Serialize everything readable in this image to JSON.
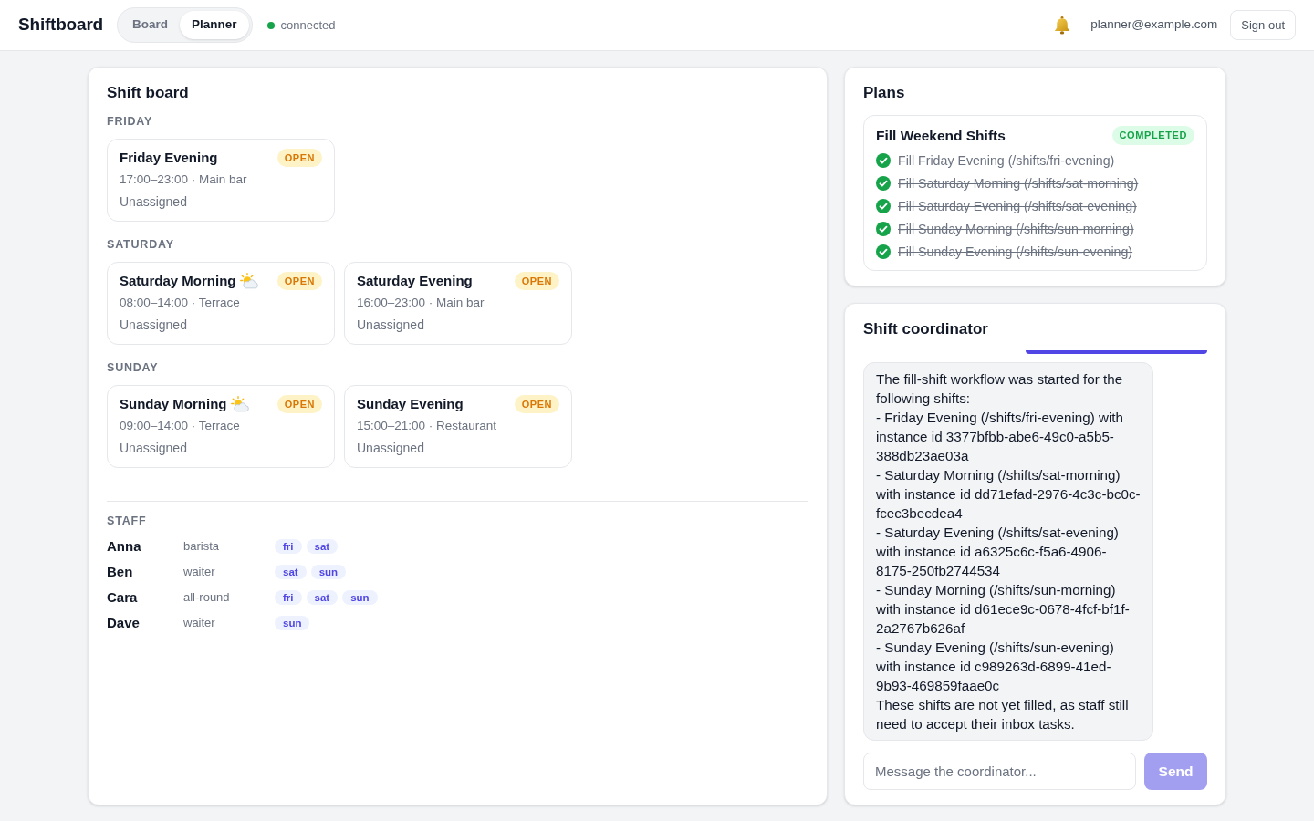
{
  "app": {
    "title": "Shiftboard"
  },
  "nav_tabs": [
    {
      "label": "Board",
      "selected": false
    },
    {
      "label": "Planner",
      "selected": true
    }
  ],
  "connection": {
    "label": "connected",
    "online": true
  },
  "account": {
    "email": "planner@example.com",
    "sign_out": "Sign out"
  },
  "shift_board": {
    "title": "Shift board",
    "days": [
      {
        "label": "FRIDAY",
        "shifts": [
          {
            "kind": "evening",
            "title": "Friday Evening",
            "status": "OPEN",
            "detail": "17:00–23:00 · Main bar",
            "assignee": "Unassigned"
          }
        ]
      },
      {
        "label": "SATURDAY",
        "shifts": [
          {
            "kind": "morning",
            "title": "Saturday Morning",
            "status": "OPEN",
            "detail": "08:00–14:00 · Terrace",
            "assignee": "Unassigned"
          },
          {
            "kind": "evening",
            "title": "Saturday Evening",
            "status": "OPEN",
            "detail": "16:00–23:00 · Main bar",
            "assignee": "Unassigned"
          }
        ]
      },
      {
        "label": "SUNDAY",
        "shifts": [
          {
            "kind": "morning",
            "title": "Sunday Morning",
            "status": "OPEN",
            "detail": "09:00–14:00 · Terrace",
            "assignee": "Unassigned"
          },
          {
            "kind": "evening",
            "title": "Sunday Evening",
            "status": "OPEN",
            "detail": "15:00–21:00 · Restaurant",
            "assignee": "Unassigned"
          }
        ]
      }
    ],
    "staff": {
      "label": "STAFF",
      "members": [
        {
          "name": "Anna",
          "role": "barista",
          "days": [
            "fri",
            "sat"
          ]
        },
        {
          "name": "Ben",
          "role": "waiter",
          "days": [
            "sat",
            "sun"
          ]
        },
        {
          "name": "Cara",
          "role": "all-round",
          "days": [
            "fri",
            "sat",
            "sun"
          ]
        },
        {
          "name": "Dave",
          "role": "waiter",
          "days": [
            "sun"
          ]
        }
      ]
    }
  },
  "plans": {
    "title": "Plans",
    "items": [
      {
        "title": "Fill Weekend Shifts",
        "status": "COMPLETED",
        "steps": [
          {
            "label": "Fill Friday Evening (/shifts/fri-evening)",
            "done": true
          },
          {
            "label": "Fill Saturday Morning (/shifts/sat-morning)",
            "done": true
          },
          {
            "label": "Fill Saturday Evening (/shifts/sat-evening)",
            "done": true
          },
          {
            "label": "Fill Sunday Morning (/shifts/sun-morning)",
            "done": true
          },
          {
            "label": "Fill Sunday Evening (/shifts/sun-evening)",
            "done": true
          }
        ]
      }
    ]
  },
  "coordinator": {
    "title": "Shift coordinator",
    "messages": [
      {
        "kind": "user"
      },
      {
        "kind": "assistant",
        "text": "The fill-shift workflow was started for the following shifts:\n- Friday Evening (/shifts/fri-evening) with instance id 3377bfbb-abe6-49c0-a5b5-388db23ae03a\n- Saturday Morning (/shifts/sat-morning) with instance id dd71efad-2976-4c3c-bc0c-fcec3becdea4\n- Saturday Evening (/shifts/sat-evening) with instance id a6325c6c-f5a6-4906-8175-250fb2744534\n- Sunday Morning (/shifts/sun-morning) with instance id d61ece9c-0678-4fcf-bf1f-2a2767b626af\n- Sunday Evening (/shifts/sun-evening) with instance id c989263d-6899-41ed-9b93-469859faae0c\nThese shifts are not yet filled, as staff still need to accept their inbox tasks."
      }
    ],
    "composer": {
      "placeholder": "Message the coordinator...",
      "send": {
        "label": "Send",
        "disabled": true
      }
    }
  }
}
